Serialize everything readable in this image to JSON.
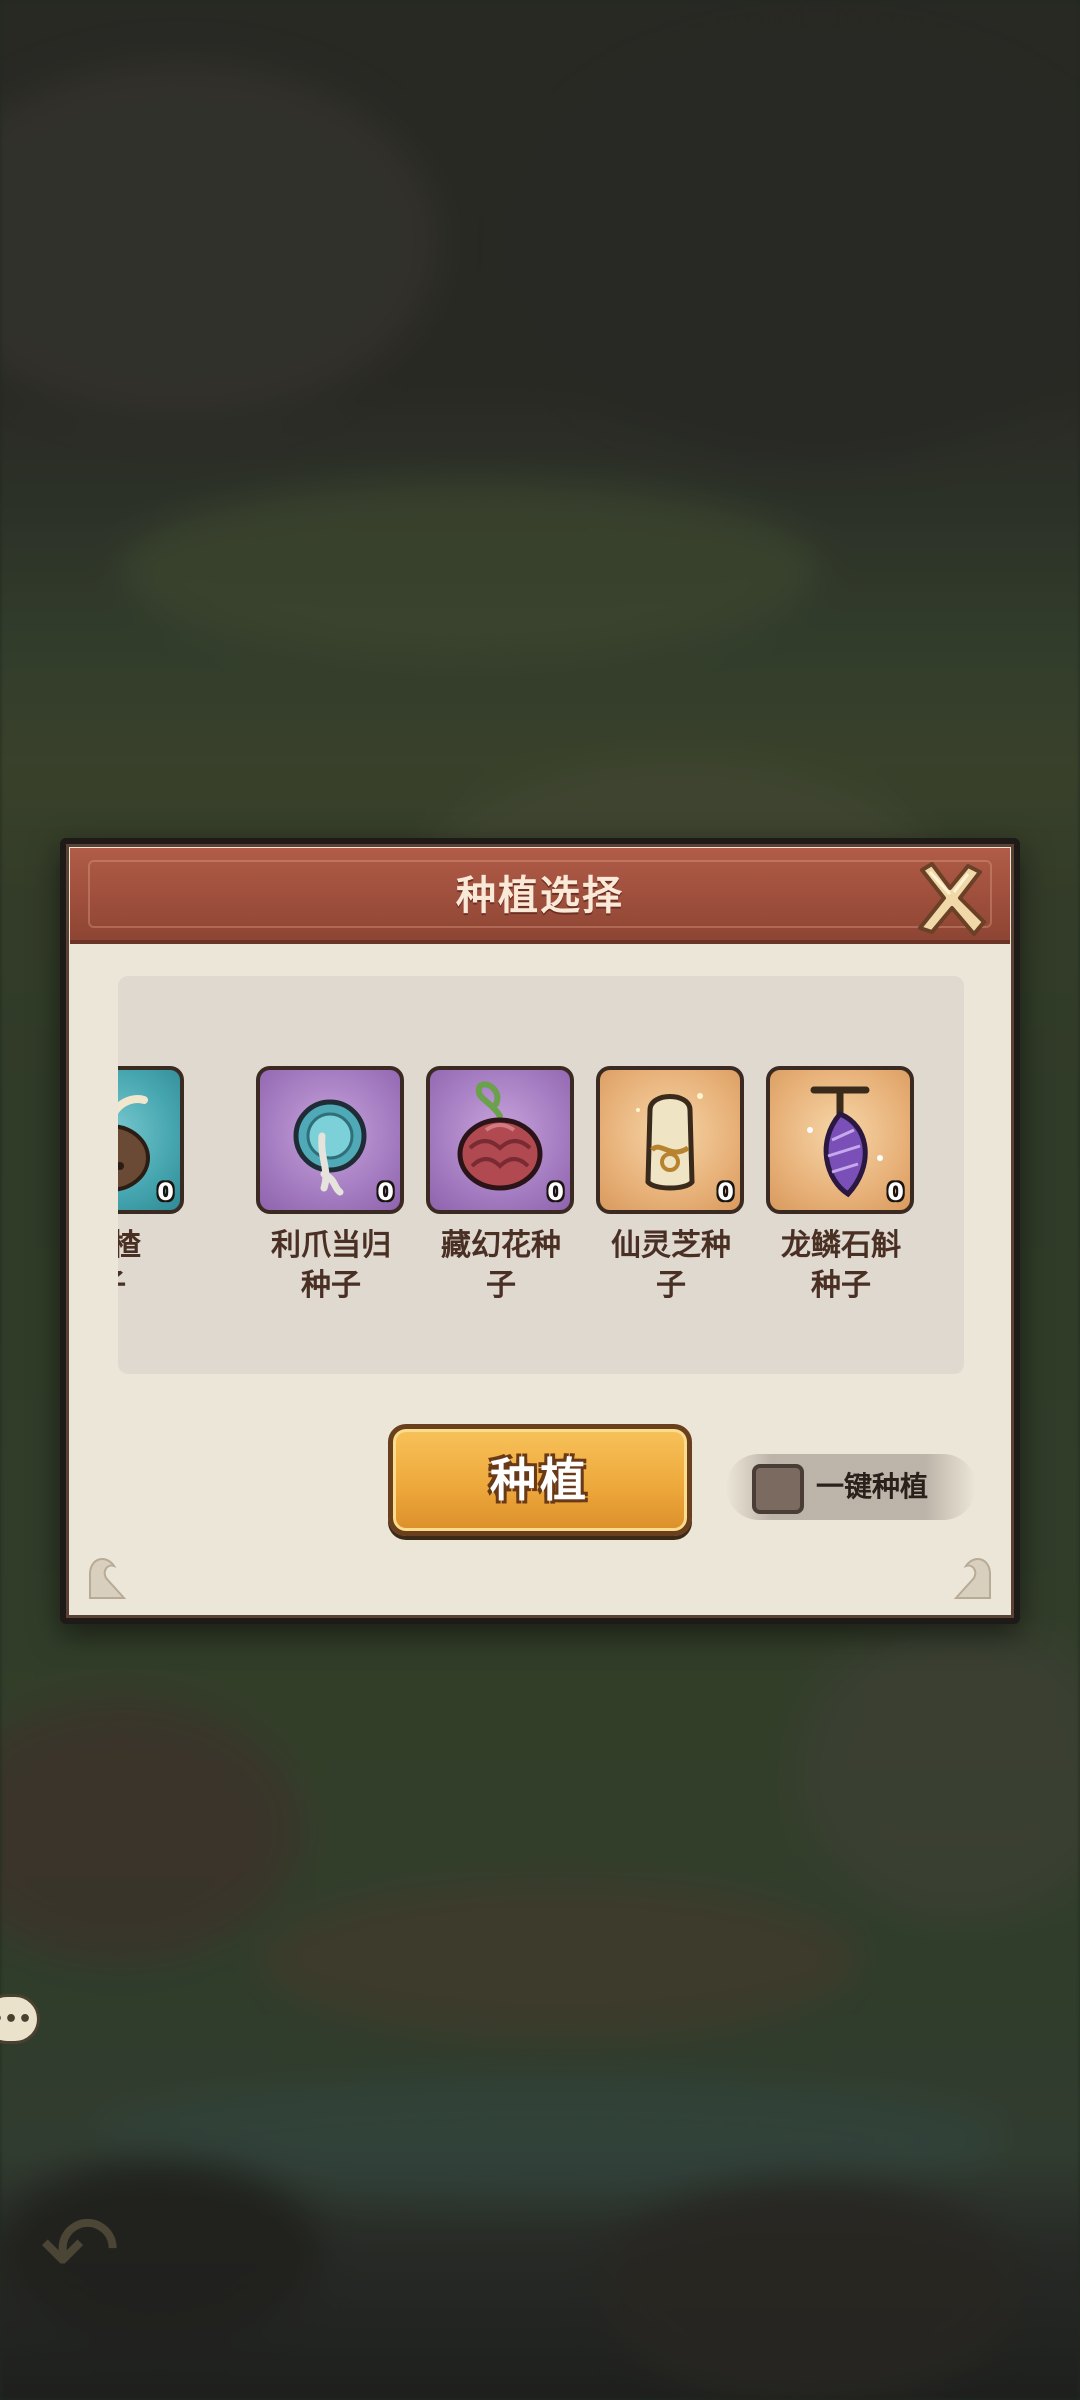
{
  "dialog": {
    "title": "种植选择"
  },
  "seeds": [
    {
      "name": "山楂\n子",
      "count": "0",
      "color": "teal",
      "icon": "hawthorn-seed-icon"
    },
    {
      "name": "利爪当归\n种子",
      "count": "0",
      "color": "purple",
      "icon": "claw-angelica-seed-icon"
    },
    {
      "name": "藏幻花种\n子",
      "count": "0",
      "color": "purple",
      "icon": "illusion-flower-seed-icon"
    },
    {
      "name": "仙灵芝种\n子",
      "count": "0",
      "color": "gold",
      "icon": "lingzhi-seed-icon"
    },
    {
      "name": "龙鳞石斛\n种子",
      "count": "0",
      "color": "gold",
      "icon": "dragon-scale-dendrobium-seed-icon"
    }
  ],
  "actions": {
    "plant_label": "种植",
    "one_key_plant_label": "一键种植",
    "one_key_plant_checked": false
  },
  "colors": {
    "header": "#a4543f",
    "plant_button": "#eea93c",
    "panel": "#dfd9cf"
  }
}
